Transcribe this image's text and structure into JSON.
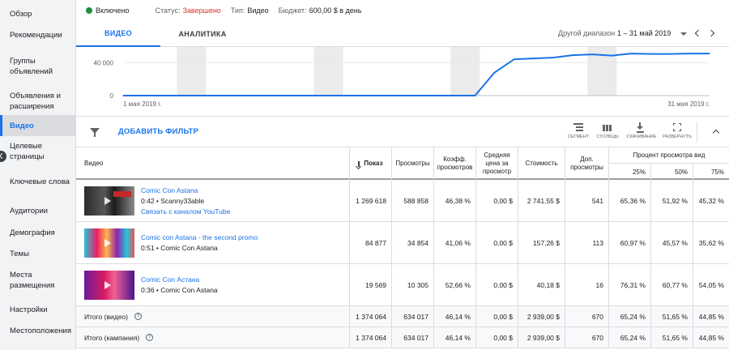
{
  "sidebar": {
    "items": [
      {
        "label": "Обзор"
      },
      {
        "label": "Рекомендации"
      },
      {
        "label": "Группы объявлений"
      },
      {
        "label": "Объявления и расширения"
      },
      {
        "label": "Видео"
      },
      {
        "label": "Целевые страницы"
      },
      {
        "label": "Ключевые слова"
      },
      {
        "label": "Аудитории"
      },
      {
        "label": "Демография"
      },
      {
        "label": "Темы"
      },
      {
        "label": "Места размещения"
      },
      {
        "label": "Настройки"
      },
      {
        "label": "Местоположения"
      }
    ],
    "active_index": 4
  },
  "status": {
    "enabled": "Включено",
    "status_label": "Статус:",
    "status_value": "Завершено",
    "type_label": "Тип:",
    "type_value": "Видео",
    "budget_label": "Бюджет:",
    "budget_value": "600,00 $ в день"
  },
  "tabs": [
    {
      "label": "ВИДЕО"
    },
    {
      "label": "АНАЛИТИКА"
    }
  ],
  "date_range": {
    "label": "Другой диапазон",
    "value": "1 – 31 май 2019"
  },
  "chart_data": {
    "type": "line",
    "ytick": "40 000",
    "ytick_zero": "0",
    "xlabel_start": "1 мая 2019 г.",
    "xlabel_end": "31 мая 2019 г.",
    "ylim": [
      0,
      55000
    ],
    "x_days": [
      1,
      2,
      3,
      4,
      5,
      6,
      7,
      8,
      9,
      10,
      11,
      12,
      13,
      14,
      15,
      16,
      17,
      18,
      19,
      20,
      21,
      22,
      23,
      24,
      25,
      26,
      27,
      28,
      29,
      30,
      31
    ],
    "values": [
      0,
      0,
      0,
      0,
      0,
      0,
      0,
      0,
      0,
      0,
      0,
      0,
      0,
      0,
      0,
      0,
      0,
      0,
      0,
      28000,
      44000,
      45000,
      46000,
      49000,
      50000,
      48500,
      51000,
      50500,
      50500,
      51000,
      51000
    ],
    "weekend_bands": [
      [
        4,
        5
      ],
      [
        11,
        12
      ],
      [
        18,
        19
      ],
      [
        25,
        26
      ]
    ],
    "line_color": "#1a73e8"
  },
  "toolbar": {
    "add_filter": "ДОБАВИТЬ ФИЛЬТР",
    "segment": "Сегмент",
    "columns": "Столбцы",
    "download": "Скачивание",
    "expand": "Развернуть"
  },
  "table": {
    "headers": {
      "video": "Видео",
      "impressions": "Показ",
      "views": "Просмотры",
      "view_rate": "Коэфф. просмотров",
      "avg_cpv": "Средняя цена за просмотр",
      "cost": "Стоимость",
      "earned_views": "Доп. просмотры",
      "view_pct_group": "Процент просмотра вид",
      "p25": "25%",
      "p50": "50%",
      "p75": "75%"
    },
    "rows": [
      {
        "title": "Comic Con Astana",
        "duration": "0:42",
        "channel": "Scanny33able",
        "link": "Связать с каналом YouTube",
        "impressions": "1 269 618",
        "views": "588 858",
        "view_rate": "46,38 %",
        "avg_cpv": "0,00 $",
        "cost": "2 741,55 $",
        "earned_views": "541",
        "p25": "65,36 %",
        "p50": "51,92 %",
        "p75": "45,32 %"
      },
      {
        "title": "Comic con Astana - the second promo",
        "duration": "0:51",
        "channel": "Comic Con Astana",
        "link": "",
        "impressions": "84 877",
        "views": "34 854",
        "view_rate": "41,06 %",
        "avg_cpv": "0,00 $",
        "cost": "157,26 $",
        "earned_views": "113",
        "p25": "60,97 %",
        "p50": "45,57 %",
        "p75": "35,62 %"
      },
      {
        "title": "Comic Con Астана",
        "duration": "0:36",
        "channel": "Comic Con Astana",
        "link": "",
        "impressions": "19 569",
        "views": "10 305",
        "view_rate": "52,66 %",
        "avg_cpv": "0,00 $",
        "cost": "40,18 $",
        "earned_views": "16",
        "p25": "76,31 %",
        "p50": "60,77 %",
        "p75": "54,05 %"
      }
    ],
    "totals": [
      {
        "label": "Итого (видео)",
        "impressions": "1 374 064",
        "views": "634 017",
        "view_rate": "46,14 %",
        "avg_cpv": "0,00 $",
        "cost": "2 939,00 $",
        "earned_views": "670",
        "p25": "65,24 %",
        "p50": "51,65 %",
        "p75": "44,85 %"
      },
      {
        "label": "Итого (кампания)",
        "impressions": "1 374 064",
        "views": "634 017",
        "view_rate": "46,14 %",
        "avg_cpv": "0,00 $",
        "cost": "2 939,00 $",
        "earned_views": "670",
        "p25": "65,24 %",
        "p50": "51,65 %",
        "p75": "44,85 %"
      }
    ]
  }
}
